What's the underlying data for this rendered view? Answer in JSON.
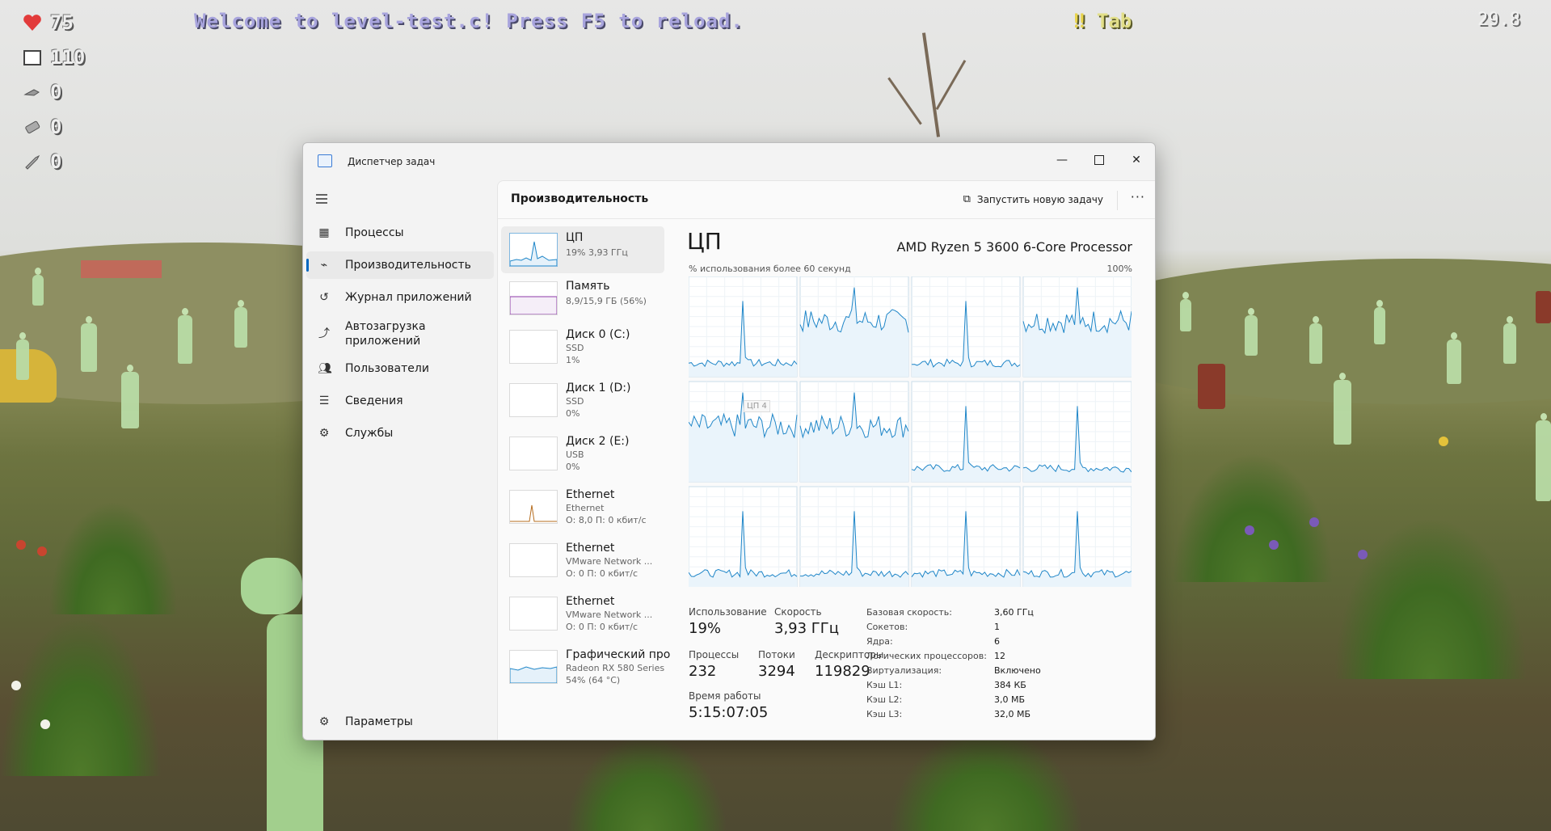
{
  "hud": {
    "health": "75",
    "armor": "110",
    "ammo1": "0",
    "ammo2": "0",
    "ammo3": "0",
    "welcome": "Welcome to level-test.c! Press F5 to reload.",
    "tab_hint": "Tab",
    "fps": "29.8"
  },
  "window": {
    "title": "Диспетчер задач",
    "page_title": "Производительность",
    "new_task": "Запустить новую задачу",
    "more": "···"
  },
  "nav": {
    "items": [
      {
        "label": "Процессы",
        "icon": "processes-icon"
      },
      {
        "label": "Производительность",
        "icon": "performance-icon"
      },
      {
        "label": "Журнал приложений",
        "icon": "app-history-icon"
      },
      {
        "label": "Автозагрузка приложений",
        "icon": "startup-icon"
      },
      {
        "label": "Пользователи",
        "icon": "users-icon"
      },
      {
        "label": "Сведения",
        "icon": "details-icon"
      },
      {
        "label": "Службы",
        "icon": "services-icon"
      }
    ],
    "settings": "Параметры"
  },
  "resources": [
    {
      "name": "ЦП",
      "sub1": "19% 3,93 ГГц",
      "sub2": "",
      "sub3": ""
    },
    {
      "name": "Память",
      "sub1": "8,9/15,9 ГБ (56%)",
      "sub2": "",
      "sub3": ""
    },
    {
      "name": "Диск 0 (C:)",
      "sub1": "SSD",
      "sub2": "1%",
      "sub3": ""
    },
    {
      "name": "Диск 1 (D:)",
      "sub1": "SSD",
      "sub2": "0%",
      "sub3": ""
    },
    {
      "name": "Диск 2 (E:)",
      "sub1": "USB",
      "sub2": "0%",
      "sub3": ""
    },
    {
      "name": "Ethernet",
      "sub1": "Ethernet",
      "sub2": "О: 8,0 П: 0 кбит/с",
      "sub3": ""
    },
    {
      "name": "Ethernet",
      "sub1": "VMware Network ...",
      "sub2": "О: 0 П: 0 кбит/с",
      "sub3": ""
    },
    {
      "name": "Ethernet",
      "sub1": "VMware Network ...",
      "sub2": "О: 0 П: 0 кбит/с",
      "sub3": ""
    },
    {
      "name": "Графический про",
      "sub1": "Radeon RX 580 Series",
      "sub2": "54% (64 °C)",
      "sub3": ""
    }
  ],
  "cpu": {
    "title": "ЦП",
    "model": "AMD Ryzen 5 3600 6-Core Processor",
    "util_label": "% использования более 60 секунд",
    "util_max": "100%",
    "tooltip": "ЦП 4",
    "graph_color": "#1f86c8",
    "fill_color": "#eaf4fb",
    "stats": {
      "usage_label": "Использование",
      "usage": "19%",
      "speed_label": "Скорость",
      "speed": "3,93 ГГц",
      "proc_label": "Процессы",
      "proc": "232",
      "threads_label": "Потоки",
      "threads": "3294",
      "handles_label": "Дескрипторы",
      "handles": "119829",
      "uptime_label": "Время работы",
      "uptime": "5:15:07:05"
    },
    "details": [
      {
        "k": "Базовая скорость:",
        "v": "3,60 ГГц"
      },
      {
        "k": "Сокетов:",
        "v": "1"
      },
      {
        "k": "Ядра:",
        "v": "6"
      },
      {
        "k": "Логических процессоров:",
        "v": "12"
      },
      {
        "k": "Виртуализация:",
        "v": "Включено"
      },
      {
        "k": "Кэш L1:",
        "v": "384 КБ"
      },
      {
        "k": "Кэш L2:",
        "v": "3,0 МБ"
      },
      {
        "k": "Кэш L3:",
        "v": "32,0 МБ"
      }
    ]
  }
}
